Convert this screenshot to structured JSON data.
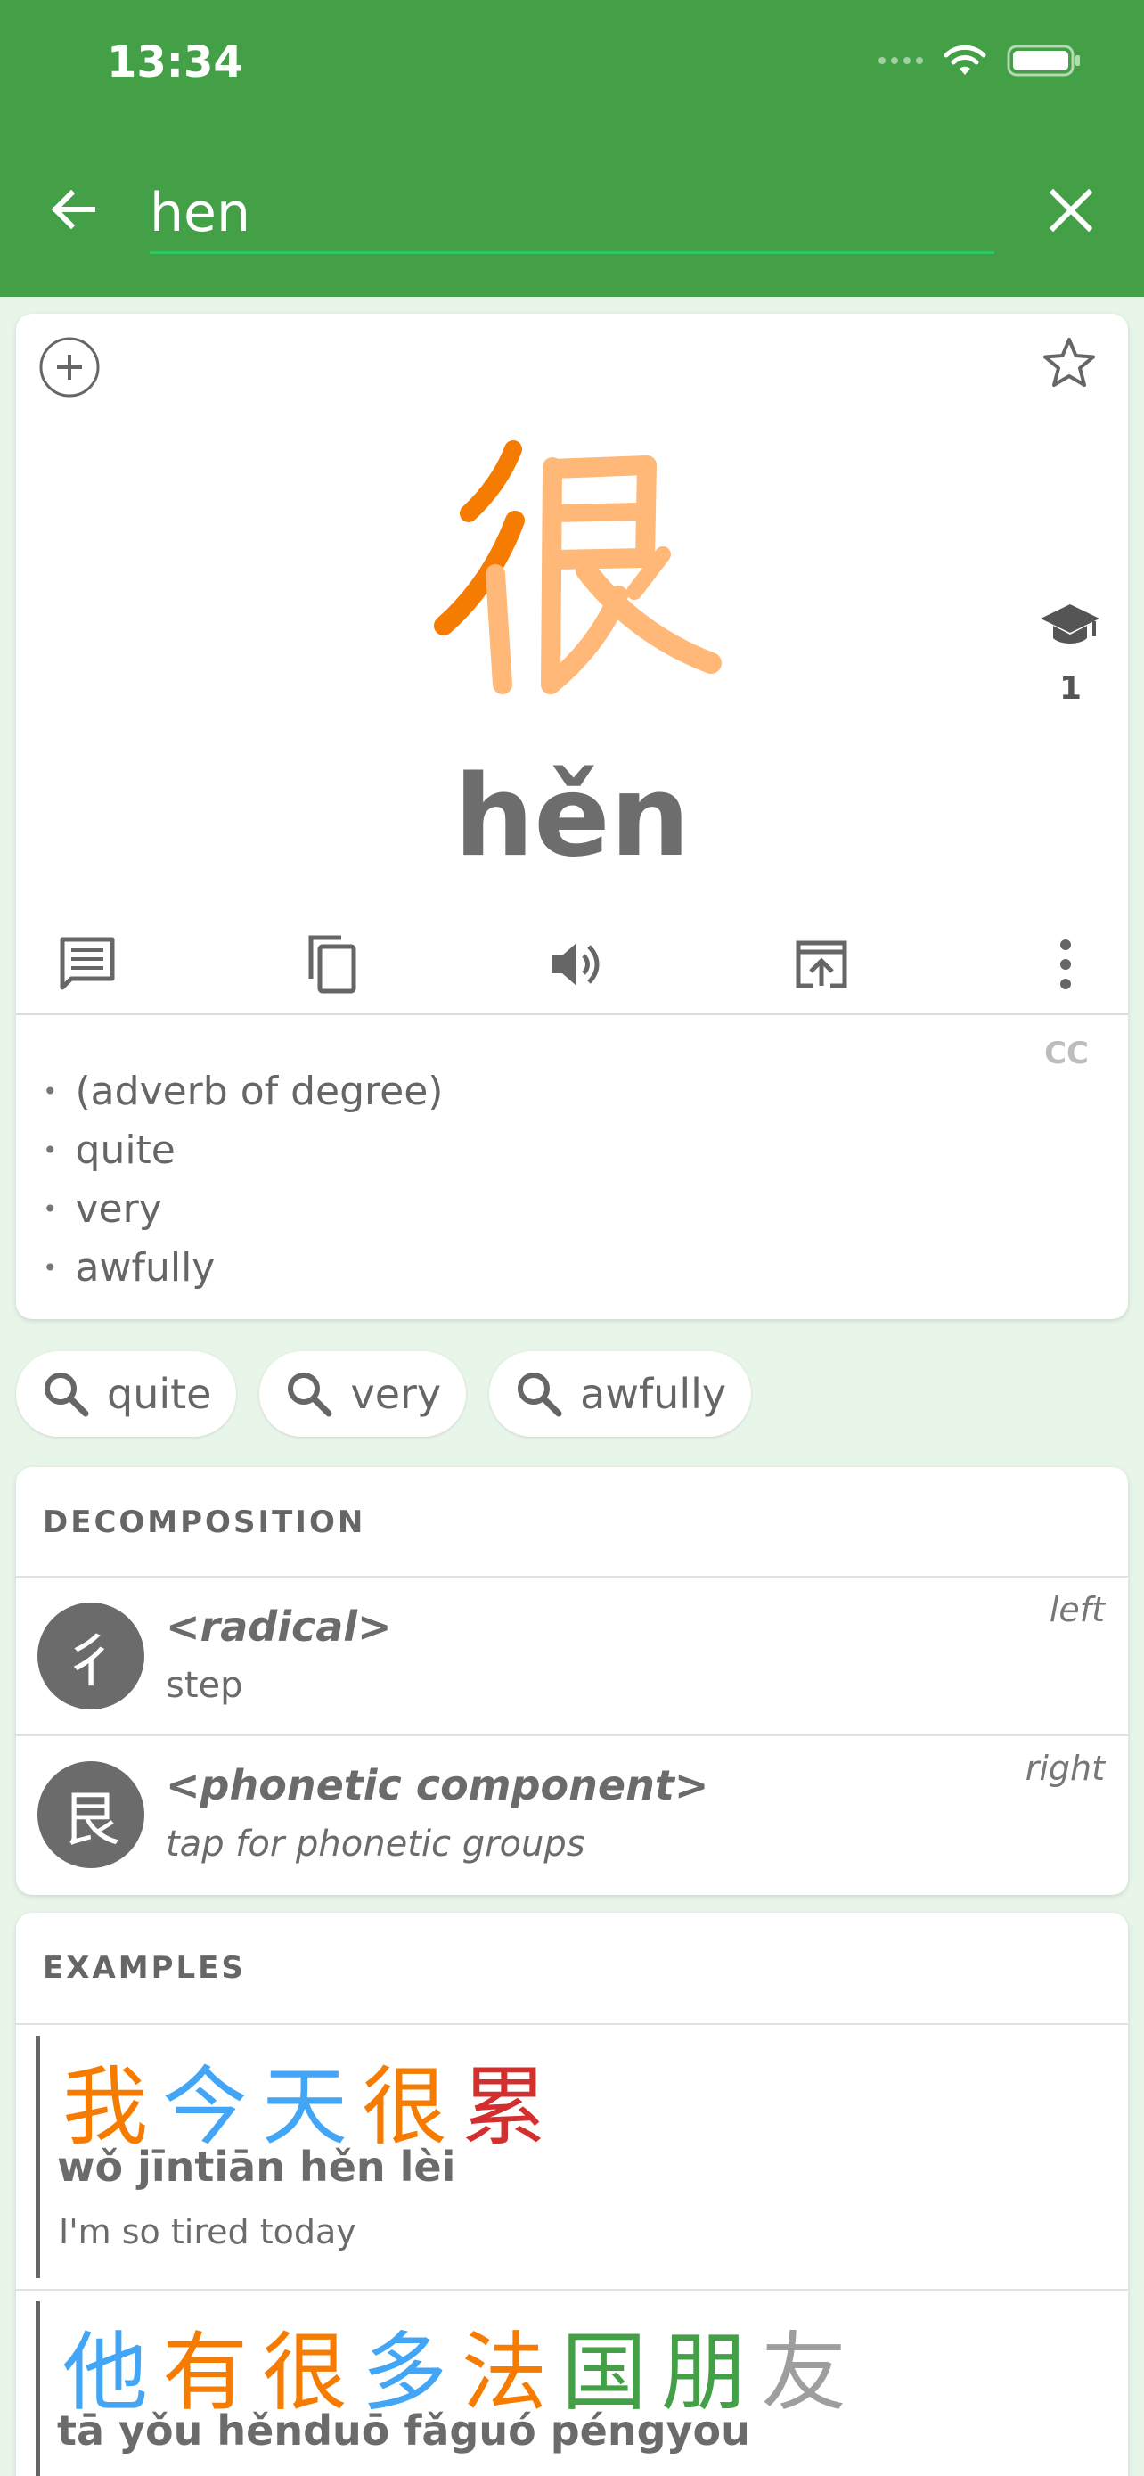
{
  "status": {
    "time": "13:34"
  },
  "search": {
    "query": "hen"
  },
  "entry": {
    "character": "很",
    "pinyin": "hěn",
    "hsk_level": "1",
    "source": "CC",
    "definitions": [
      "(adverb of degree)",
      "quite",
      "very",
      "awfully"
    ]
  },
  "chips": [
    {
      "label": "quite"
    },
    {
      "label": "very"
    },
    {
      "label": "awfully"
    }
  ],
  "decomposition": {
    "title": "DECOMPOSITION",
    "items": [
      {
        "char": "彳",
        "title": "<radical>",
        "subtitle": "step",
        "position": "left"
      },
      {
        "char": "艮",
        "title": "<phonetic component>",
        "subtitle": "tap for phonetic groups",
        "position": "right"
      }
    ]
  },
  "examples": {
    "title": "EXAMPLES",
    "items": [
      {
        "chars": [
          "我",
          "今",
          "天",
          "很",
          "累"
        ],
        "pinyin": "wǒ jīntiān hěn lèi",
        "translation": "I'm so tired today"
      },
      {
        "chars": [
          "他",
          "有",
          "很",
          "多",
          "法",
          "国",
          "朋",
          "友"
        ],
        "pinyin": "tā yǒu hěnduō fǎguó péngyou",
        "translation": ""
      }
    ]
  },
  "colors": {
    "header": "#43a047",
    "background": "#e8f5e9",
    "tone3": "#f57c00",
    "tone1": "#42a5f5",
    "tone4": "#d32f2f",
    "tone2": "#43a047",
    "neutral": "#9e9e9e"
  }
}
